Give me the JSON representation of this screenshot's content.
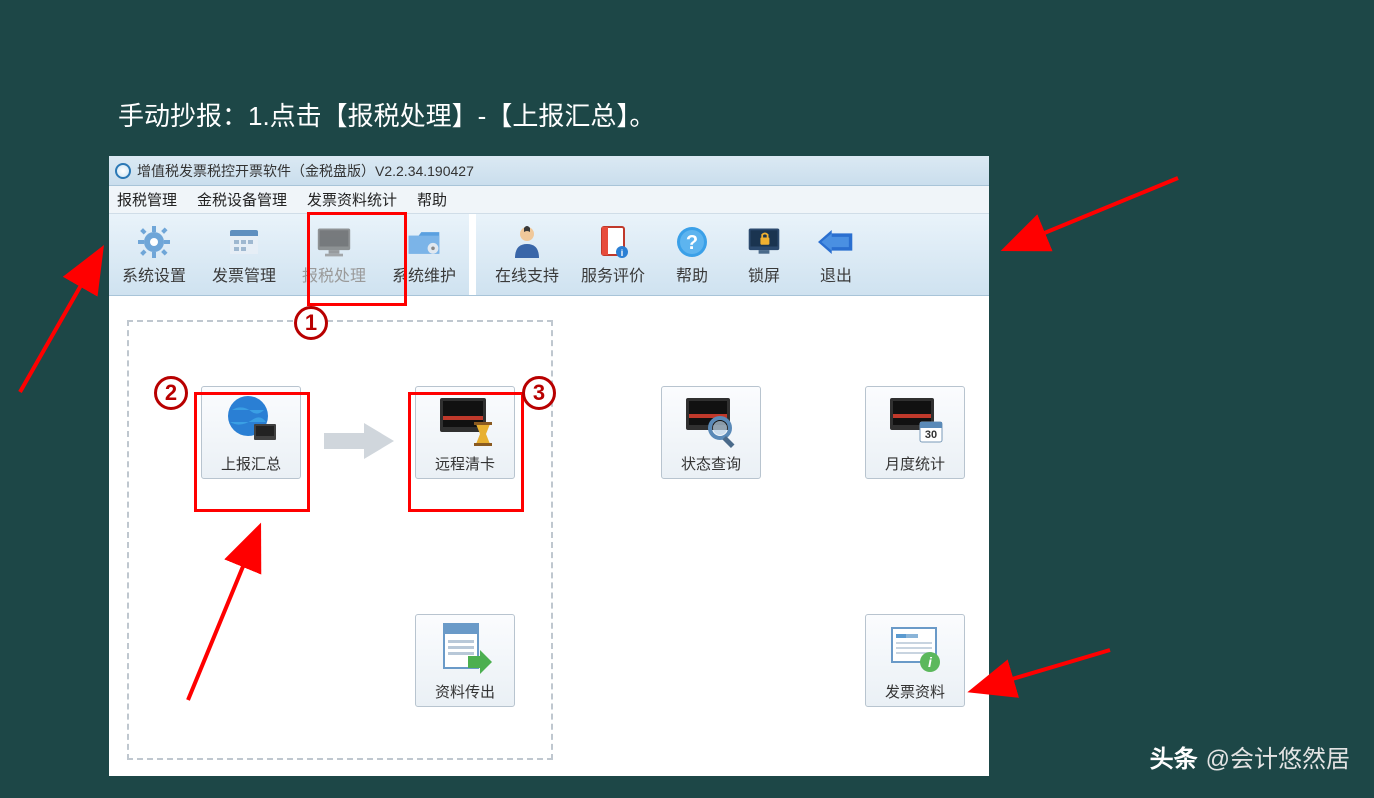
{
  "instruction": "手动抄报：1.点击【报税处理】-【上报汇总】。",
  "titlebar": {
    "title": "增值税发票税控开票软件（金税盘版）V2.2.34.190427"
  },
  "menubar": {
    "items": [
      "报税管理",
      "金税设备管理",
      "发票资料统计",
      "帮助"
    ]
  },
  "toolbar": {
    "left": [
      {
        "label": "系统设置",
        "icon": "gear-icon"
      },
      {
        "label": "发票管理",
        "icon": "calendar-icon"
      },
      {
        "label": "报税处理",
        "icon": "monitor-icon",
        "disabled": true
      },
      {
        "label": "系统维护",
        "icon": "folder-gear-icon"
      }
    ],
    "right": [
      {
        "label": "在线支持",
        "icon": "person-icon"
      },
      {
        "label": "服务评价",
        "icon": "notebook-icon"
      },
      {
        "label": "帮助",
        "icon": "help-icon"
      },
      {
        "label": "锁屏",
        "icon": "lock-monitor-icon"
      },
      {
        "label": "退出",
        "icon": "exit-arrow-icon"
      }
    ]
  },
  "tiles": {
    "report_summary": "上报汇总",
    "remote_clear": "远程清卡",
    "status_query": "状态查询",
    "monthly_stats": "月度统计",
    "data_export": "资料传出",
    "invoice_info": "发票资料"
  },
  "markers": {
    "m1": "1",
    "m2": "2",
    "m3": "3"
  },
  "watermark": {
    "logo": "头条",
    "text": "@会计悠然居"
  }
}
